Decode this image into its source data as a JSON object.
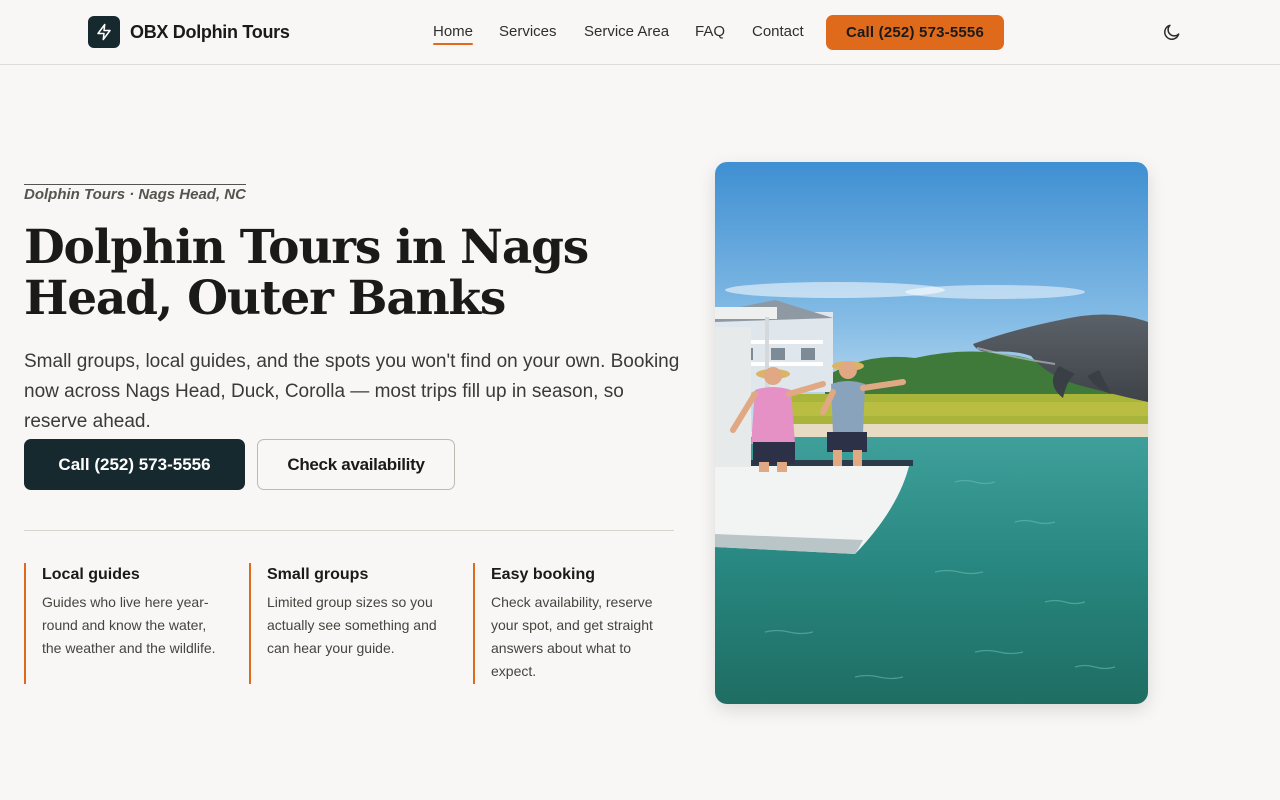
{
  "header": {
    "brand": "OBX Dolphin Tours",
    "logo_icon": "bolt-icon",
    "nav": [
      {
        "label": "Home",
        "active": true
      },
      {
        "label": "Services",
        "active": false
      },
      {
        "label": "Service Area",
        "active": false
      },
      {
        "label": "FAQ",
        "active": false
      },
      {
        "label": "Contact",
        "active": false
      }
    ],
    "cta_label": "Call (252) 573-5556",
    "theme_toggle_icon": "moon-icon"
  },
  "hero": {
    "eyebrow": "Dolphin Tours · Nags Head, NC",
    "title": "Dolphin Tours in Nags Head, Outer Banks",
    "lead": "Small groups, local guides, and the spots you won't find on your own. Booking now across Nags Head, Duck, Corolla — most trips fill up in season, so reserve ahead.",
    "primary_button": "Call (252) 573-5556",
    "secondary_button": "Check availability",
    "features": [
      {
        "title": "Local guides",
        "text": "Guides who live here year-round and know the water, the weather and the wildlife."
      },
      {
        "title": "Small groups",
        "text": "Limited group sizes so you actually see something and can hear your guide."
      },
      {
        "title": "Easy booking",
        "text": "Check availability, reserve your spot, and get straight answers about what to expect."
      }
    ]
  },
  "colors": {
    "accent": "#e06a1b",
    "dark": "#16292e",
    "background": "#f8f7f5"
  }
}
